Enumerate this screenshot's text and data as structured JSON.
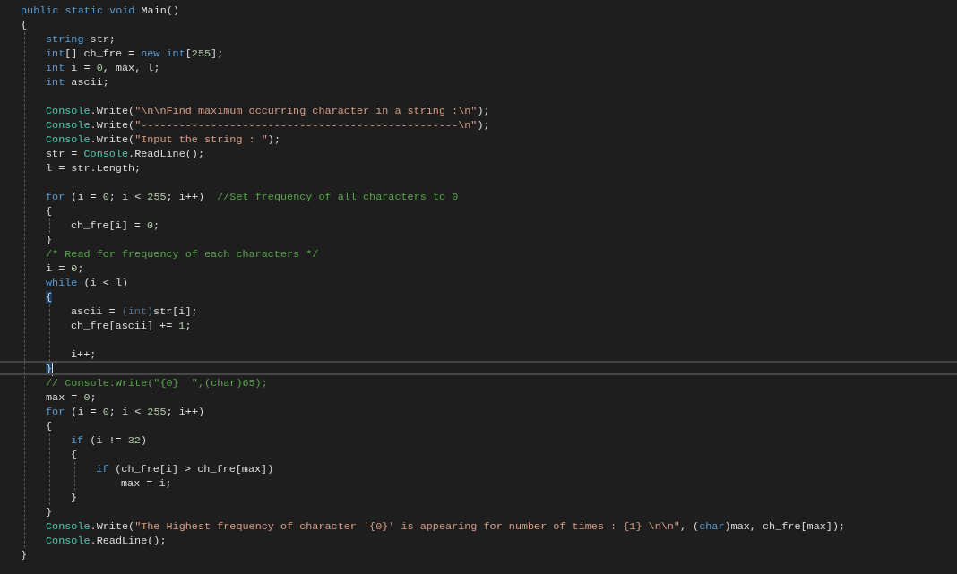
{
  "editor": {
    "lines": [
      {
        "current": false,
        "tokens": [
          {
            "kind": "keyword",
            "text": "public static void"
          },
          {
            "kind": "plain",
            "text": " Main()"
          }
        ]
      },
      {
        "current": false,
        "tokens": [
          {
            "kind": "plain",
            "text": "{"
          }
        ],
        "guide": true,
        "children": [
          {
            "current": false,
            "tokens": [
              {
                "kind": "keyword",
                "text": "string"
              },
              {
                "kind": "plain",
                "text": " str;"
              }
            ]
          },
          {
            "current": false,
            "tokens": [
              {
                "kind": "keyword",
                "text": "int"
              },
              {
                "kind": "plain",
                "text": "[] ch_fre = "
              },
              {
                "kind": "keyword",
                "text": "new int"
              },
              {
                "kind": "plain",
                "text": "["
              },
              {
                "kind": "number",
                "text": "255"
              },
              {
                "kind": "plain",
                "text": "];"
              }
            ]
          },
          {
            "current": false,
            "tokens": [
              {
                "kind": "keyword",
                "text": "int"
              },
              {
                "kind": "plain",
                "text": " i = "
              },
              {
                "kind": "number",
                "text": "0"
              },
              {
                "kind": "plain",
                "text": ", max, l;"
              }
            ]
          },
          {
            "current": false,
            "tokens": [
              {
                "kind": "keyword",
                "text": "int"
              },
              {
                "kind": "plain",
                "text": " ascii;"
              }
            ]
          },
          {
            "kind": "blank"
          },
          {
            "current": false,
            "tokens": [
              {
                "kind": "type",
                "text": "Console"
              },
              {
                "kind": "plain",
                "text": ".Write("
              },
              {
                "kind": "string",
                "text": "\"\\n\\nFind maximum occurring character in a string :\\n\""
              },
              {
                "kind": "plain",
                "text": ");"
              }
            ]
          },
          {
            "current": false,
            "tokens": [
              {
                "kind": "type",
                "text": "Console"
              },
              {
                "kind": "plain",
                "text": ".Write("
              },
              {
                "kind": "string",
                "text": "\"--------------------------------------------------\\n\""
              },
              {
                "kind": "plain",
                "text": ");"
              }
            ]
          },
          {
            "current": false,
            "tokens": [
              {
                "kind": "type",
                "text": "Console"
              },
              {
                "kind": "plain",
                "text": ".Write("
              },
              {
                "kind": "string",
                "text": "\"Input the string : \""
              },
              {
                "kind": "plain",
                "text": ");"
              }
            ]
          },
          {
            "current": false,
            "tokens": [
              {
                "kind": "plain",
                "text": "str = "
              },
              {
                "kind": "type",
                "text": "Console"
              },
              {
                "kind": "plain",
                "text": ".ReadLine();"
              }
            ]
          },
          {
            "current": false,
            "tokens": [
              {
                "kind": "plain",
                "text": "l = str.Length;"
              }
            ]
          },
          {
            "kind": "blank"
          },
          {
            "current": false,
            "tokens": [
              {
                "kind": "keyword",
                "text": "for"
              },
              {
                "kind": "plain",
                "text": " (i = "
              },
              {
                "kind": "number",
                "text": "0"
              },
              {
                "kind": "plain",
                "text": "; i < "
              },
              {
                "kind": "number",
                "text": "255"
              },
              {
                "kind": "plain",
                "text": "; i++)  "
              },
              {
                "kind": "comment",
                "text": "//Set frequency of all characters to 0"
              }
            ]
          },
          {
            "current": false,
            "tokens": [
              {
                "kind": "plain",
                "text": "{"
              }
            ],
            "guide": true,
            "children": [
              {
                "current": false,
                "tokens": [
                  {
                    "kind": "plain",
                    "text": "ch_fre[i] = "
                  },
                  {
                    "kind": "number",
                    "text": "0"
                  },
                  {
                    "kind": "plain",
                    "text": ";"
                  }
                ]
              }
            ]
          },
          {
            "current": false,
            "tokens": [
              {
                "kind": "plain",
                "text": "}"
              }
            ]
          },
          {
            "current": false,
            "tokens": [
              {
                "kind": "comment",
                "text": "/* Read for frequency of each characters */"
              }
            ]
          },
          {
            "current": false,
            "tokens": [
              {
                "kind": "plain",
                "text": "i = "
              },
              {
                "kind": "number",
                "text": "0"
              },
              {
                "kind": "plain",
                "text": ";"
              }
            ]
          },
          {
            "current": false,
            "tokens": [
              {
                "kind": "keyword",
                "text": "while"
              },
              {
                "kind": "plain",
                "text": " (i < l)"
              }
            ]
          },
          {
            "current": false,
            "tokens": [
              {
                "kind": "match",
                "text": "{"
              }
            ],
            "guide": true,
            "children": [
              {
                "current": false,
                "tokens": [
                  {
                    "kind": "plain",
                    "text": "ascii = "
                  },
                  {
                    "kind": "faded",
                    "text": "(int)"
                  },
                  {
                    "kind": "plain",
                    "text": "str[i];"
                  }
                ]
              },
              {
                "current": false,
                "tokens": [
                  {
                    "kind": "plain",
                    "text": "ch_fre[ascii] += "
                  },
                  {
                    "kind": "number",
                    "text": "1"
                  },
                  {
                    "kind": "plain",
                    "text": ";"
                  }
                ]
              },
              {
                "kind": "blank"
              },
              {
                "current": false,
                "tokens": [
                  {
                    "kind": "plain",
                    "text": "i++;"
                  }
                ]
              }
            ]
          },
          {
            "current": true,
            "tokens": [
              {
                "kind": "match",
                "text": "}"
              }
            ]
          },
          {
            "current": false,
            "tokens": [
              {
                "kind": "comment",
                "text": "// Console.Write(\"{0}  \",(char)65);"
              }
            ]
          },
          {
            "current": false,
            "tokens": [
              {
                "kind": "plain",
                "text": "max = "
              },
              {
                "kind": "number",
                "text": "0"
              },
              {
                "kind": "plain",
                "text": ";"
              }
            ]
          },
          {
            "current": false,
            "tokens": [
              {
                "kind": "keyword",
                "text": "for"
              },
              {
                "kind": "plain",
                "text": " (i = "
              },
              {
                "kind": "number",
                "text": "0"
              },
              {
                "kind": "plain",
                "text": "; i < "
              },
              {
                "kind": "number",
                "text": "255"
              },
              {
                "kind": "plain",
                "text": "; i++)"
              }
            ]
          },
          {
            "current": false,
            "tokens": [
              {
                "kind": "plain",
                "text": "{"
              }
            ],
            "guide": true,
            "children": [
              {
                "current": false,
                "tokens": [
                  {
                    "kind": "keyword",
                    "text": "if"
                  },
                  {
                    "kind": "plain",
                    "text": " (i != "
                  },
                  {
                    "kind": "number",
                    "text": "32"
                  },
                  {
                    "kind": "plain",
                    "text": ")"
                  }
                ]
              },
              {
                "current": false,
                "tokens": [
                  {
                    "kind": "plain",
                    "text": "{"
                  }
                ],
                "guide": true,
                "children": [
                  {
                    "current": false,
                    "tokens": [
                      {
                        "kind": "keyword",
                        "text": "if"
                      },
                      {
                        "kind": "plain",
                        "text": " (ch_fre[i] > ch_fre[max])"
                      }
                    ],
                    "guide": false,
                    "children": [
                      {
                        "current": false,
                        "tokens": [
                          {
                            "kind": "plain",
                            "text": "max = i;"
                          }
                        ]
                      }
                    ]
                  }
                ]
              },
              {
                "current": false,
                "tokens": [
                  {
                    "kind": "plain",
                    "text": "}"
                  }
                ]
              }
            ]
          },
          {
            "current": false,
            "tokens": [
              {
                "kind": "plain",
                "text": "}"
              }
            ]
          },
          {
            "current": false,
            "tokens": [
              {
                "kind": "type",
                "text": "Console"
              },
              {
                "kind": "plain",
                "text": ".Write("
              },
              {
                "kind": "string",
                "text": "\"The Highest frequency of character '{0}' is appearing for number of times : {1} \\n\\n\""
              },
              {
                "kind": "plain",
                "text": ", ("
              },
              {
                "kind": "keyword",
                "text": "char"
              },
              {
                "kind": "plain",
                "text": ")max, ch_fre[max]);"
              }
            ]
          },
          {
            "current": false,
            "tokens": [
              {
                "kind": "type",
                "text": "Console"
              },
              {
                "kind": "plain",
                "text": ".ReadLine();"
              }
            ]
          }
        ]
      },
      {
        "current": false,
        "tokens": [
          {
            "kind": "plain",
            "text": "}"
          }
        ]
      }
    ]
  }
}
